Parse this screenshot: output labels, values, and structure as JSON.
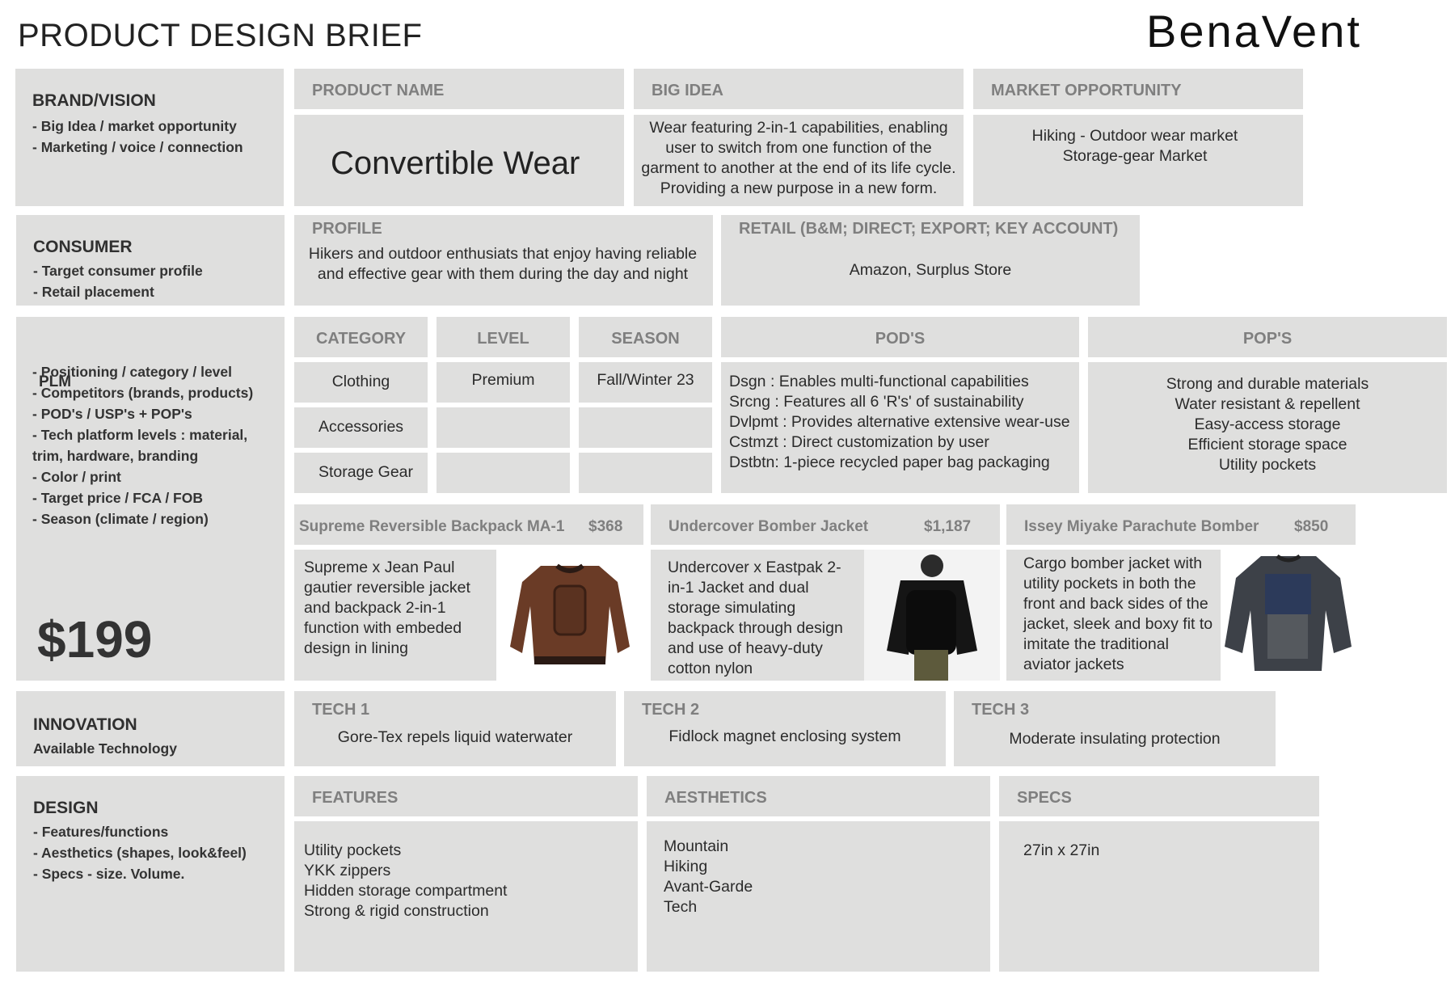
{
  "page_title": "PRODUCT DESIGN BRIEF",
  "brand_logo": "BenaVent",
  "brand": {
    "title": "BRAND/VISION",
    "items": "- Big Idea / market opportunity\n- Marketing / voice / connection",
    "product_name_header": "PRODUCT NAME",
    "product_name": "Convertible Wear",
    "big_idea_header": "BIG IDEA",
    "big_idea": "Wear featuring 2-in-1 capabilities, enabling user to switch from one function of the garment to another at the end of its life cycle. Providing a new purpose in a new form.",
    "market_header": "MARKET OPPORTUNITY",
    "market": "Hiking - Outdoor wear market\nStorage-gear Market"
  },
  "consumer": {
    "title": "CONSUMER",
    "items": "- Target consumer profile\n- Retail placement",
    "profile_header": "PROFILE",
    "profile": "Hikers and outdoor enthusiats that enjoy having reliable and effective gear with them during the day and night",
    "retail_header": "RETAIL (B&M; DIRECT; EXPORT; KEY ACCOUNT)",
    "retail": "Amazon, Surplus Store"
  },
  "plm": {
    "title": "PLM",
    "items": "- Positioning / category / level\n- Competitors (brands, products)\n- POD's / USP's + POP's\n- Tech platform levels : material, trim, hardware, branding\n- Color / print\n- Target price / FCA / FOB\n- Season (climate / region)",
    "price": "$199",
    "category_header": "CATEGORY",
    "categories": [
      "Clothing",
      "Accessories",
      "Storage Gear"
    ],
    "level_header": "LEVEL",
    "level": "Premium",
    "season_header": "SEASON",
    "season": "Fall/Winter 23",
    "pods_header": "POD'S",
    "pods": "Dsgn : Enables multi-functional capabilities\nSrcng : Features all 6 'R's' of sustainability\nDvlpmt : Provides alternative extensive wear-use\nCstmzt : Direct customization by user\nDstbtn: 1-piece recycled paper bag packaging",
    "pops_header": "POP'S",
    "pops": "Strong and durable materials\nWater resistant & repellent\nEasy-access storage\nEfficient storage space\nUtility pockets",
    "competitors": [
      {
        "name": "Supreme Reversible Backpack MA-1",
        "price": "$368",
        "desc": "Supreme x Jean Paul gautier reversible jacket and backpack 2-in-1 function with embeded design in lining",
        "image": "brown-bomber-jacket-with-backpack"
      },
      {
        "name": "Undercover Bomber Jacket",
        "price": "$1,187",
        "desc": "Undercover x Eastpak 2-in-1 Jacket and dual storage simulating backpack through design and use of heavy-duty cotton nylon",
        "image": "black-jacket-backpack-model"
      },
      {
        "name": "Issey Miyake Parachute Bomber",
        "price": "$850",
        "desc": "Cargo bomber jacket with utility pockets in both the front and back sides of the jacket, sleek and boxy fit to imitate the traditional aviator jackets",
        "image": "dark-grey-parachute-bomber"
      }
    ]
  },
  "innovation": {
    "title": "INNOVATION",
    "items": "Available Technology",
    "techs": [
      {
        "header": "TECH 1",
        "text": "Gore-Tex repels liquid waterwater"
      },
      {
        "header": "TECH 2",
        "text": "Fidlock magnet enclosing system"
      },
      {
        "header": "TECH 3",
        "text": "Moderate insulating protection"
      }
    ]
  },
  "design": {
    "title": "DESIGN",
    "items": "- Features/functions\n- Aesthetics (shapes, look&feel)\n- Specs - size.  Volume.",
    "features_header": "FEATURES",
    "features": "Utility pockets\nYKK zippers\nHidden storage compartment\nStrong & rigid construction",
    "aesthetics_header": "AESTHETICS",
    "aesthetics": "Mountain\nHiking\nAvant-Garde\nTech",
    "specs_header": "SPECS",
    "specs": "27in x 27in"
  },
  "colors": {
    "panel": "#dfdfde",
    "header_text": "#7f7f7f",
    "body_text": "#2b2b2b"
  }
}
